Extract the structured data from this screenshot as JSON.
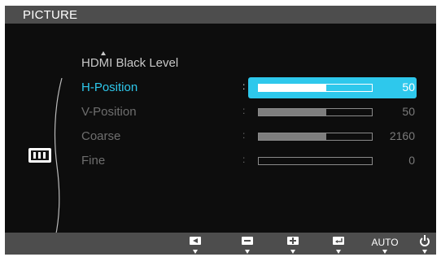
{
  "menu": {
    "title": "PICTURE",
    "items": [
      {
        "label": "HDMI Black Level"
      },
      {
        "label": "H-Position",
        "value": "50",
        "level": 0.6,
        "selected": true
      },
      {
        "label": "V-Position",
        "value": "50",
        "level": 0.6
      },
      {
        "label": "Coarse",
        "value": "2160",
        "level": 0.6
      },
      {
        "label": "Fine",
        "value": "0",
        "level": 0
      }
    ],
    "separator": ":"
  },
  "bottom": {
    "buttons": [
      {
        "icon": "left-arrow-icon"
      },
      {
        "icon": "minus-icon"
      },
      {
        "icon": "plus-icon"
      },
      {
        "icon": "enter-icon"
      },
      {
        "label": "AUTO"
      },
      {
        "icon": "power-icon"
      }
    ]
  },
  "colors": {
    "accent": "#2ec8ec",
    "panel": "#0d0d0d",
    "bar_bg": "#4d4d4d"
  }
}
